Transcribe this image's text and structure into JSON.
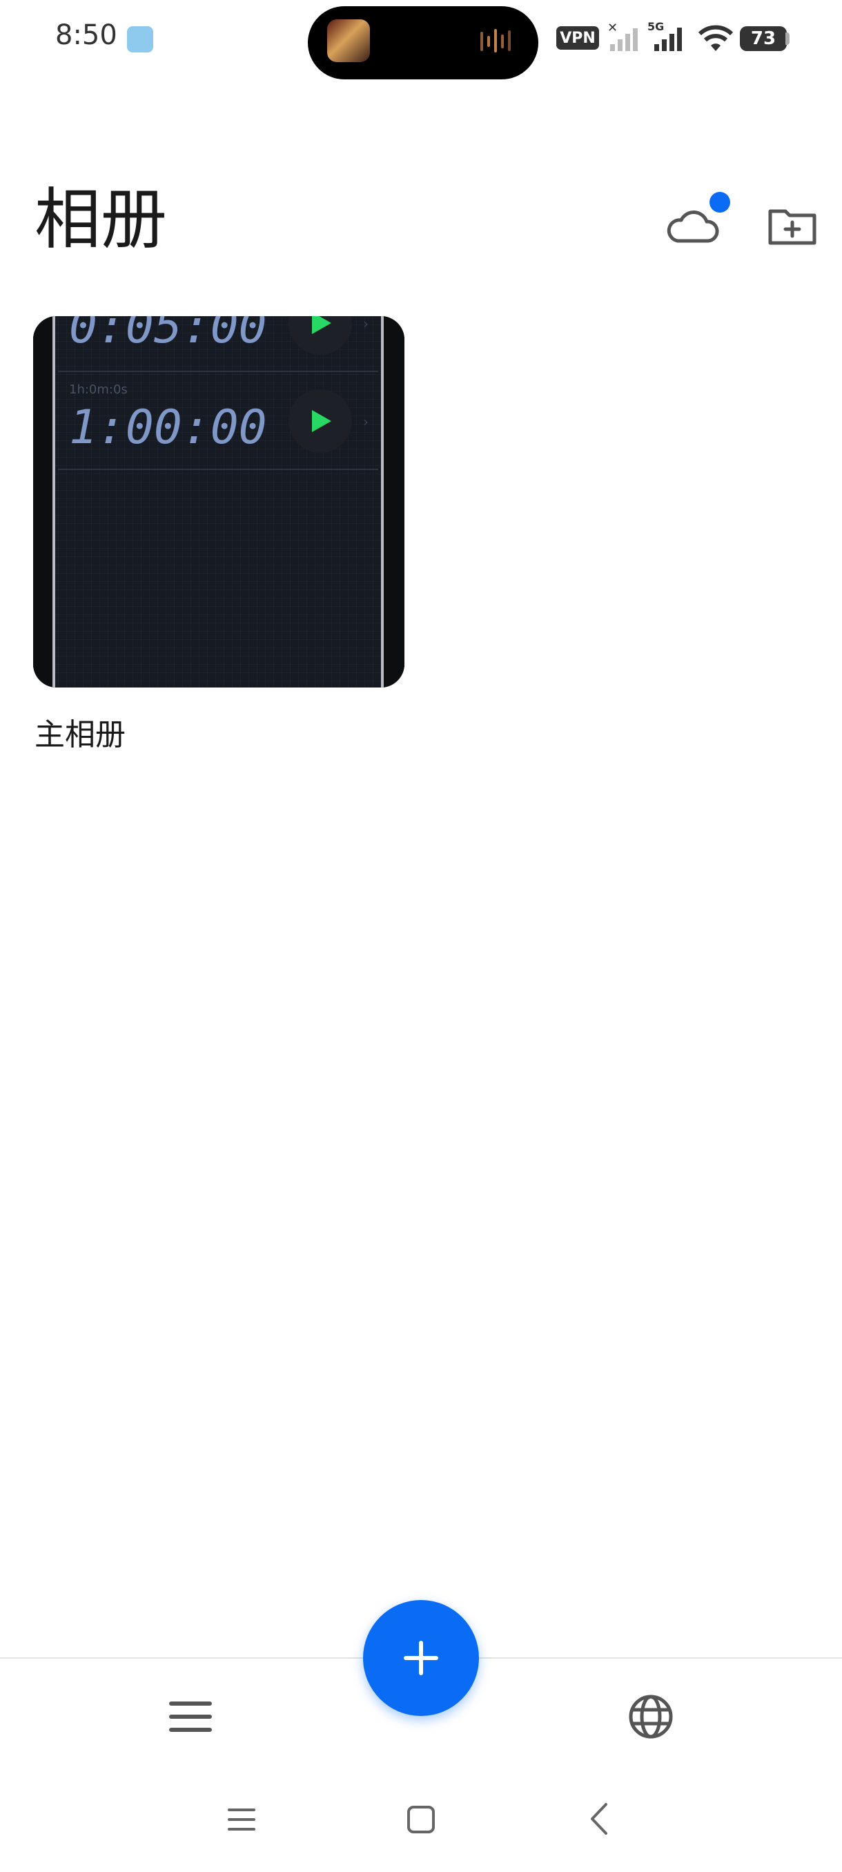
{
  "status_bar": {
    "time": "8:50",
    "vpn_label": "VPN",
    "network_label": "5G",
    "battery": "73"
  },
  "header": {
    "title": "相册"
  },
  "albums": [
    {
      "name": "主相册",
      "thumbnail_times": [
        "0:05:00",
        "1:00:00"
      ],
      "thumbnail_caption": "1h:0m:0s"
    }
  ],
  "colors": {
    "accent": "#0a6cf5",
    "text": "#1a1a1a",
    "icon": "#555555"
  },
  "icons": {
    "cloud": "cloud-icon",
    "new_folder": "folder-plus-icon",
    "add": "plus-icon",
    "menu": "menu-icon",
    "globe": "globe-icon"
  }
}
